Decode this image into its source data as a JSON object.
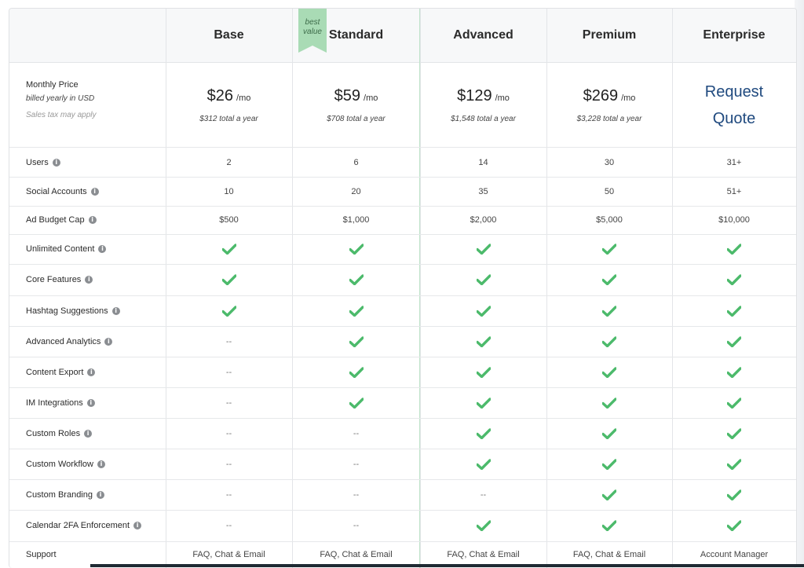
{
  "plans": [
    "Base",
    "Standard",
    "Advanced",
    "Premium",
    "Enterprise"
  ],
  "ribbon": {
    "line1": "best",
    "line2": "value"
  },
  "price_row": {
    "label": "Monthly Price",
    "sub": "billed yearly in USD",
    "tax": "Sales tax may apply",
    "amounts": [
      "$26",
      "$59",
      "$129",
      "$269"
    ],
    "per": "/mo",
    "totals": [
      "$312 total a year",
      "$708 total a year",
      "$1,548 total a year",
      "$3,228 total a year"
    ],
    "enterprise_line1": "Request",
    "enterprise_line2": "Quote"
  },
  "features": [
    {
      "label": "Users",
      "values": [
        "2",
        "6",
        "14",
        "30",
        "31+"
      ]
    },
    {
      "label": "Social Accounts",
      "values": [
        "10",
        "20",
        "35",
        "50",
        "51+"
      ]
    },
    {
      "label": "Ad Budget Cap",
      "values": [
        "$500",
        "$1,000",
        "$2,000",
        "$5,000",
        "$10,000"
      ]
    },
    {
      "label": "Unlimited Content",
      "values": [
        "check",
        "check",
        "check",
        "check",
        "check"
      ]
    },
    {
      "label": "Core Features",
      "values": [
        "check",
        "check",
        "check",
        "check",
        "check"
      ]
    },
    {
      "label": "Hashtag Suggestions",
      "values": [
        "check",
        "check",
        "check",
        "check",
        "check"
      ]
    },
    {
      "label": "Advanced Analytics",
      "values": [
        "--",
        "check",
        "check",
        "check",
        "check"
      ]
    },
    {
      "label": "Content Export",
      "values": [
        "--",
        "check",
        "check",
        "check",
        "check"
      ]
    },
    {
      "label": "IM Integrations",
      "values": [
        "--",
        "check",
        "check",
        "check",
        "check"
      ]
    },
    {
      "label": "Custom Roles",
      "values": [
        "--",
        "--",
        "check",
        "check",
        "check"
      ]
    },
    {
      "label": "Custom Workflow",
      "values": [
        "--",
        "--",
        "check",
        "check",
        "check"
      ]
    },
    {
      "label": "Custom Branding",
      "values": [
        "--",
        "--",
        "--",
        "check",
        "check"
      ]
    },
    {
      "label": "Calendar 2FA Enforcement",
      "values": [
        "--",
        "--",
        "check",
        "check",
        "check"
      ]
    }
  ],
  "support": {
    "label": "Support",
    "values": [
      "FAQ, Chat & Email",
      "FAQ, Chat & Email",
      "FAQ, Chat & Email",
      "FAQ, Chat & Email",
      "Account Manager"
    ]
  },
  "colors": {
    "check": "#4cba6b",
    "quote": "#204a7f",
    "ribbon": "#a9dbb5"
  },
  "info_icon": "info-circle-icon",
  "check_icon": "check-icon"
}
